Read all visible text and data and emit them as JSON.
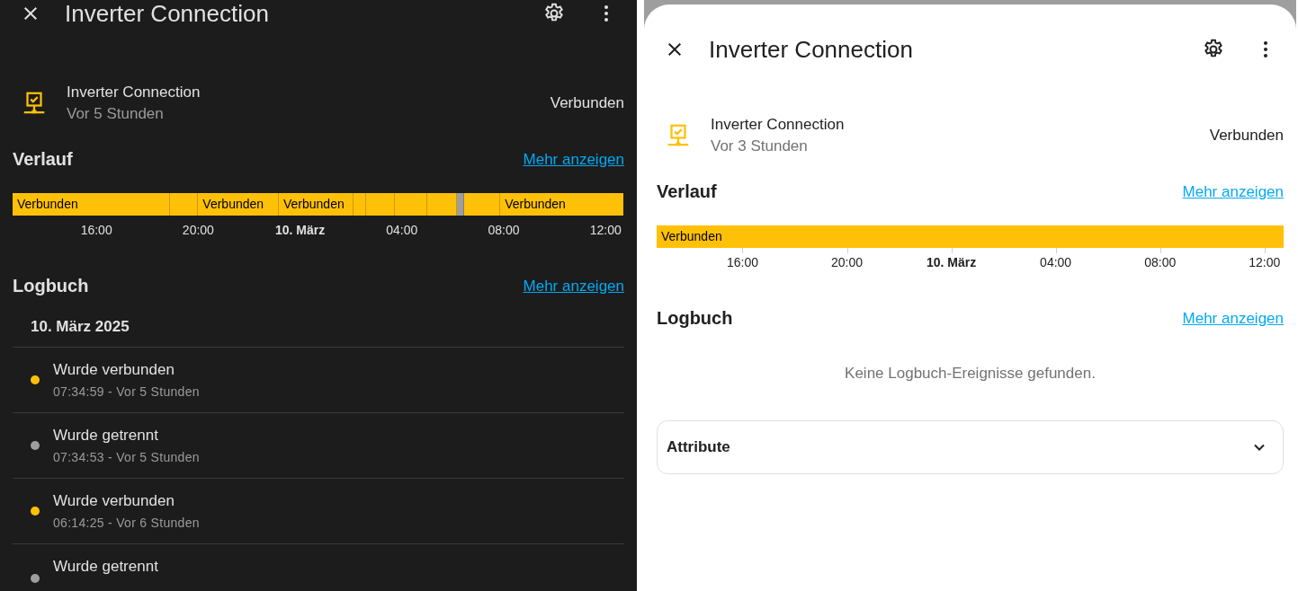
{
  "panels": [
    {
      "kind": "dark",
      "header": {
        "title": "Inverter Connection"
      },
      "entity": {
        "name": "Inverter Connection",
        "last_changed": "Vor 5 Stunden",
        "state": "Verbunden"
      },
      "history": {
        "title": "Verlauf",
        "more_link": "Mehr anzeigen",
        "timeline": {
          "segments": [
            {
              "label": "Verbunden",
              "color": "#ffc107"
            },
            {
              "color": "#ffc107"
            },
            {
              "label": "Verbunden",
              "color": "#ffc107"
            },
            {
              "label": "Verbunden",
              "color": "#ffc107"
            },
            {
              "color": "#ffc107"
            },
            {
              "color": "#ffc107"
            },
            {
              "color": "#ffc107"
            },
            {
              "color": "#ffc107"
            },
            {
              "color": "#9e9e9e"
            },
            {
              "color": "#ffc107"
            },
            {
              "label": "Verbunden",
              "color": "#ffc107"
            }
          ]
        },
        "axis_labels": [
          {
            "label": "16:00",
            "bold": false
          },
          {
            "label": "20:00",
            "bold": false
          },
          {
            "label": "10. März",
            "bold": true
          },
          {
            "label": "04:00",
            "bold": false
          },
          {
            "label": "08:00",
            "bold": false
          },
          {
            "label": "12:00",
            "bold": false
          }
        ]
      },
      "logbook": {
        "title": "Logbuch",
        "more_link": "Mehr anzeigen",
        "date": "10. März 2025",
        "entries": [
          {
            "title": "Wurde verbunden",
            "subtitle": "07:34:59 - Vor 5 Stunden",
            "color": "#ffc107"
          },
          {
            "title": "Wurde getrennt",
            "subtitle": "07:34:53 - Vor 5 Stunden",
            "color": "#9e9e9e"
          },
          {
            "title": "Wurde verbunden",
            "subtitle": "06:14:25 - Vor 6 Stunden",
            "color": "#ffc107"
          },
          {
            "title": "Wurde getrennt",
            "color": "#9e9e9e"
          }
        ]
      }
    },
    {
      "kind": "light",
      "header": {
        "title": "Inverter Connection"
      },
      "entity": {
        "name": "Inverter Connection",
        "last_changed": "Vor 3 Stunden",
        "state": "Verbunden"
      },
      "history": {
        "title": "Verlauf",
        "more_link": "Mehr anzeigen",
        "timeline": {
          "segments": [
            {
              "label": "Verbunden",
              "color": "#ffc107"
            }
          ]
        },
        "axis_labels": [
          {
            "label": "16:00",
            "bold": false
          },
          {
            "label": "20:00",
            "bold": false
          },
          {
            "label": "10. März",
            "bold": true
          },
          {
            "label": "04:00",
            "bold": false
          },
          {
            "label": "08:00",
            "bold": false
          },
          {
            "label": "12:00",
            "bold": false
          }
        ]
      },
      "logbook": {
        "title": "Logbuch",
        "more_link": "Mehr anzeigen",
        "empty_message": "Keine Logbuch-Ereignisse gefunden."
      },
      "attributes": {
        "title": "Attribute",
        "expanded": false
      }
    }
  ]
}
